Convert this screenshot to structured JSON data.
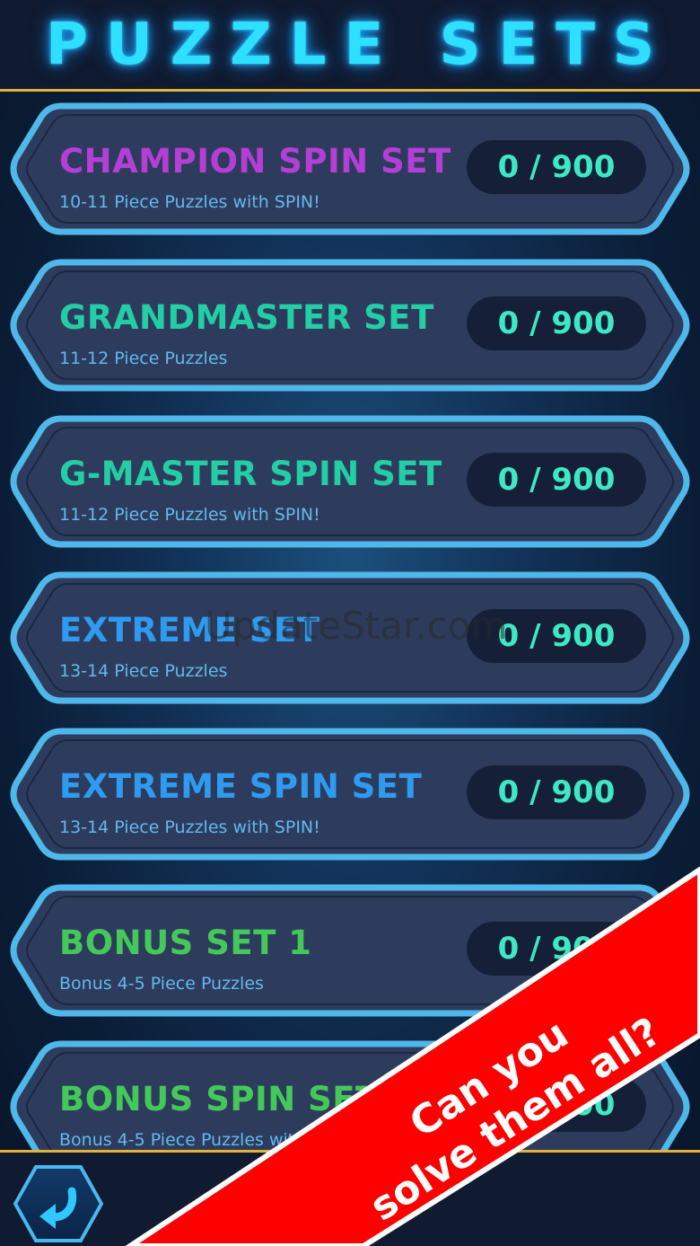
{
  "header": {
    "title": "PUZZLE SETS"
  },
  "colors": {
    "magenta": "#b43ed6",
    "teal": "#23cda6",
    "blue": "#2e9bf0",
    "green": "#45c85a",
    "progress": "#3ee8c4",
    "card_border": "#4fb8ea",
    "card_fill": "#2d3c5c",
    "gold": "#e3b23a",
    "banner_red": "#ff0000"
  },
  "sets": [
    {
      "title": "CHAMPION SPIN SET",
      "subtitle": "10-11 Piece Puzzles with SPIN!",
      "progress": "0 / 900",
      "color": "magenta"
    },
    {
      "title": "GRANDMASTER SET",
      "subtitle": "11-12 Piece Puzzles",
      "progress": "0 / 900",
      "color": "teal"
    },
    {
      "title": "G-MASTER SPIN SET",
      "subtitle": "11-12 Piece Puzzles with SPIN!",
      "progress": "0 / 900",
      "color": "teal"
    },
    {
      "title": "EXTREME SET",
      "subtitle": "13-14 Piece Puzzles",
      "progress": "0 / 900",
      "color": "blue"
    },
    {
      "title": "EXTREME SPIN SET",
      "subtitle": "13-14 Piece Puzzles with SPIN!",
      "progress": "0 / 900",
      "color": "blue"
    },
    {
      "title": "BONUS SET 1",
      "subtitle": "Bonus 4-5 Piece Puzzles",
      "progress": "0 / 900",
      "color": "green"
    },
    {
      "title": "BONUS SPIN SET",
      "subtitle": "Bonus 4-5 Piece Puzzles with SPIN!",
      "progress": "0 / 900",
      "color": "green"
    }
  ],
  "footer": {
    "back_icon": "back-arrow-icon"
  },
  "watermark": {
    "text": "UpdateStar.com"
  },
  "promo": {
    "line1": "Can you",
    "line2": "solve them all?"
  }
}
